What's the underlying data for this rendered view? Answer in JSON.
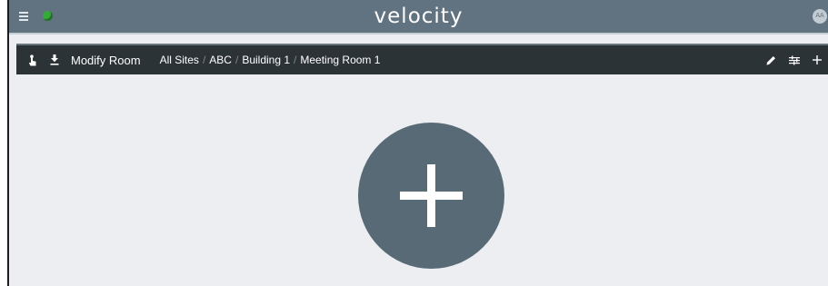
{
  "app": {
    "brand": "velocity",
    "avatar_initials": "AA"
  },
  "toolbar": {
    "title": "Modify Room",
    "breadcrumb": [
      "All Sites",
      "ABC",
      "Building 1",
      "Meeting Room 1"
    ],
    "separator": "/",
    "icons": {
      "left": [
        "touch-icon",
        "download-icon"
      ],
      "right": [
        "edit-icon",
        "settings-sliders-icon",
        "add-icon"
      ]
    }
  },
  "main": {
    "fab_icon": "plus-icon"
  },
  "colors": {
    "topbar": "#617381",
    "toolbar": "#2b3337",
    "fab": "#586a76",
    "background": "#eceef1",
    "globe": "#37a83c"
  }
}
